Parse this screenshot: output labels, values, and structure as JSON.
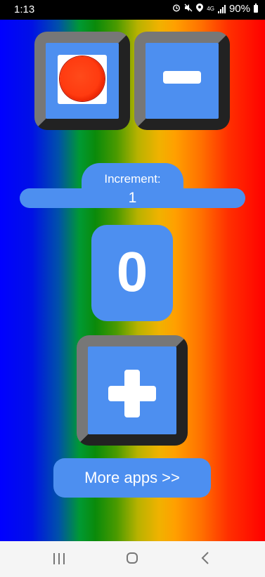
{
  "status_bar": {
    "time": "1:13",
    "network": "4G",
    "battery": "90%",
    "icons": [
      "alarm-icon",
      "mute-icon",
      "location-icon",
      "signal-icon",
      "battery-icon"
    ]
  },
  "controls": {
    "record_icon": "record-icon",
    "minus_icon": "minus-icon",
    "plus_icon": "plus-icon",
    "increment_label": "Increment:",
    "increment_value": "1",
    "counter_value": "0",
    "more_apps_label": "More apps >>"
  },
  "nav_bar": {
    "icons": [
      "recent-apps-icon",
      "home-icon",
      "back-icon"
    ]
  },
  "colors": {
    "button_blue": "#4d8ff0",
    "gradient": [
      "#0000ff",
      "#009933",
      "#f0b200",
      "#ffa000",
      "#ff0000"
    ]
  }
}
